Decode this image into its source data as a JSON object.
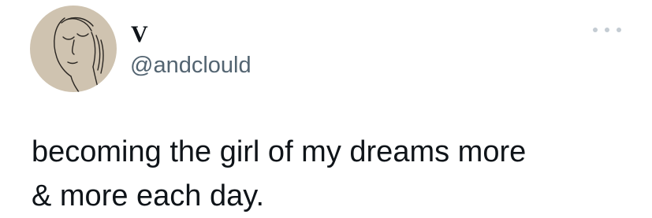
{
  "tweet": {
    "author": {
      "display_name": "V",
      "handle": "@andclould",
      "avatar_icon": "line-art-face-icon"
    },
    "more_icon": "more-options-icon",
    "text": "becoming the girl of my dreams more\n& more each day."
  },
  "colors": {
    "background": "#ffffff",
    "text": "#0f1419",
    "secondary_text": "#536471",
    "avatar_background": "#cfc3b0",
    "more_dots": "#c4ccd3"
  }
}
